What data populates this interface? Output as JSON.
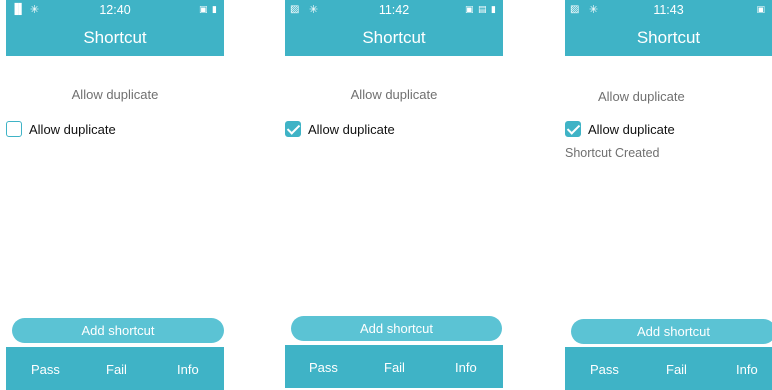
{
  "screens": [
    {
      "status": {
        "signal": "▐▌",
        "bluetooth": "✳",
        "time": "12:40",
        "right": "▣ ▮"
      },
      "title": "Shortcut",
      "label": "Allow duplicate",
      "checkbox": {
        "label": "Allow duplicate",
        "checked": false
      },
      "message": "",
      "add_button": "Add shortcut",
      "bottom": {
        "pass": "Pass",
        "fail": "Fail",
        "info": "Info"
      }
    },
    {
      "status": {
        "signal": "▨",
        "bluetooth": "✳",
        "time": "11:42",
        "right": "▣ ▤ ▮"
      },
      "title": "Shortcut",
      "label": "Allow duplicate",
      "checkbox": {
        "label": "Allow duplicate",
        "checked": true
      },
      "message": "",
      "add_button": "Add shortcut",
      "bottom": {
        "pass": "Pass",
        "fail": "Fail",
        "info": "Info"
      }
    },
    {
      "status": {
        "signal": "▨",
        "bluetooth": "✳",
        "time": "11:43",
        "right": "▣"
      },
      "title": "Shortcut",
      "label": "Allow duplicate",
      "checkbox": {
        "label": "Allow duplicate",
        "checked": true
      },
      "message": "Shortcut Created",
      "add_button": "Add shortcut",
      "bottom": {
        "pass": "Pass",
        "fail": "Fail",
        "info": "Info"
      }
    }
  ],
  "colors": {
    "accent": "#3fb3c6",
    "button": "#5bc3d4",
    "muted_text": "#707070"
  }
}
